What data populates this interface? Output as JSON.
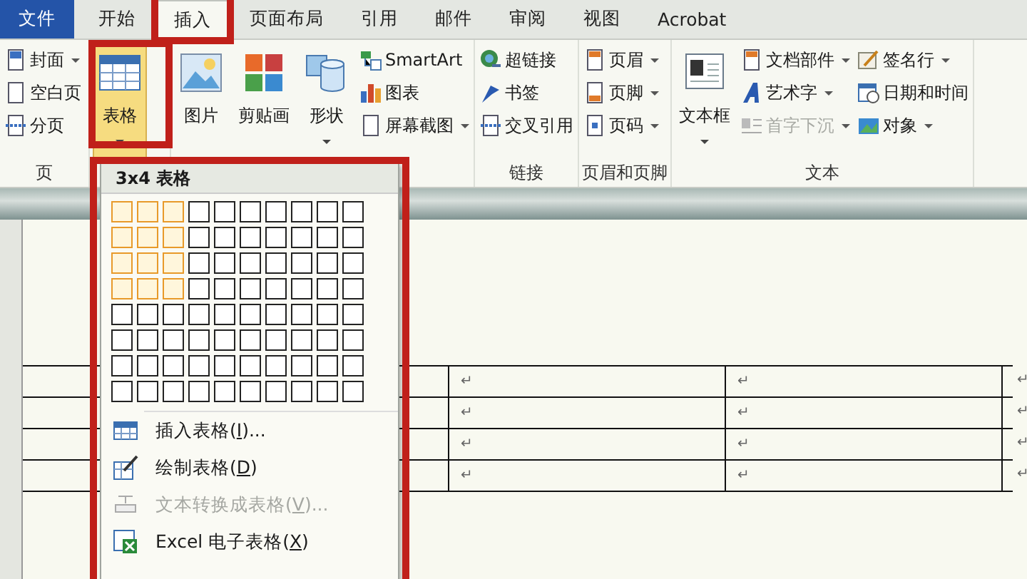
{
  "tabs": [
    {
      "label": "文件",
      "kind": "file",
      "selected": false
    },
    {
      "label": "开始",
      "kind": "tab",
      "selected": false
    },
    {
      "label": "插入",
      "kind": "tab",
      "selected": true
    },
    {
      "label": "页面布局",
      "kind": "tab",
      "selected": false
    },
    {
      "label": "引用",
      "kind": "tab",
      "selected": false
    },
    {
      "label": "邮件",
      "kind": "tab",
      "selected": false
    },
    {
      "label": "审阅",
      "kind": "tab",
      "selected": false
    },
    {
      "label": "视图",
      "kind": "tab",
      "selected": false
    },
    {
      "label": "Acrobat",
      "kind": "tab",
      "selected": false
    }
  ],
  "ribbon": {
    "groups": [
      {
        "label": "页",
        "columns": [
          {
            "kind": "small",
            "items": [
              {
                "label": "封面",
                "dropdown": true,
                "disabled": false
              },
              {
                "label": "空白页",
                "dropdown": false,
                "disabled": false
              },
              {
                "label": "分页",
                "dropdown": false,
                "disabled": false
              }
            ]
          }
        ]
      },
      {
        "columns": [
          {
            "kind": "large",
            "items": [
              {
                "label": "表格",
                "dropdown": true,
                "disabled": false,
                "pressed": true
              }
            ]
          }
        ]
      },
      {
        "columns": [
          {
            "kind": "large",
            "items": [
              {
                "label": "图片",
                "dropdown": false,
                "disabled": false,
                "pressed": false
              },
              {
                "label": "剪贴画",
                "dropdown": false,
                "disabled": false,
                "pressed": false
              },
              {
                "label": "形状",
                "dropdown": true,
                "disabled": false,
                "pressed": false
              }
            ]
          },
          {
            "kind": "small",
            "items": [
              {
                "label": "SmartArt",
                "dropdown": false,
                "disabled": false
              },
              {
                "label": "图表",
                "dropdown": false,
                "disabled": false
              },
              {
                "label": "屏幕截图",
                "dropdown": true,
                "disabled": false
              }
            ]
          }
        ]
      },
      {
        "label": "链接",
        "columns": [
          {
            "kind": "small",
            "items": [
              {
                "label": "超链接",
                "dropdown": false,
                "disabled": false
              },
              {
                "label": "书签",
                "dropdown": false,
                "disabled": false
              },
              {
                "label": "交叉引用",
                "dropdown": false,
                "disabled": false
              }
            ]
          }
        ]
      },
      {
        "label": "页眉和页脚",
        "columns": [
          {
            "kind": "small",
            "items": [
              {
                "label": "页眉",
                "dropdown": true,
                "disabled": false
              },
              {
                "label": "页脚",
                "dropdown": true,
                "disabled": false
              },
              {
                "label": "页码",
                "dropdown": true,
                "disabled": false
              }
            ]
          }
        ]
      },
      {
        "label": "文本",
        "columns": [
          {
            "kind": "large",
            "items": [
              {
                "label": "文本框",
                "dropdown": true,
                "disabled": false,
                "pressed": false
              }
            ]
          },
          {
            "kind": "small",
            "items": [
              {
                "label": "文档部件",
                "dropdown": true,
                "disabled": false
              },
              {
                "label": "艺术字",
                "dropdown": true,
                "disabled": false
              },
              {
                "label": "首字下沉",
                "dropdown": true,
                "disabled": true
              }
            ]
          },
          {
            "kind": "small",
            "items": [
              {
                "label": "签名行",
                "dropdown": true,
                "disabled": false
              },
              {
                "label": "日期和时间",
                "dropdown": false,
                "disabled": false
              },
              {
                "label": "对象",
                "dropdown": true,
                "disabled": false
              }
            ]
          }
        ]
      }
    ]
  },
  "table_menu": {
    "header": "3x4 表格",
    "grid": [
      {
        "cells": [
          {
            "selected": true
          },
          {
            "selected": true
          },
          {
            "selected": true
          },
          {
            "selected": false
          },
          {
            "selected": false
          },
          {
            "selected": false
          },
          {
            "selected": false
          },
          {
            "selected": false
          },
          {
            "selected": false
          },
          {
            "selected": false
          }
        ]
      },
      {
        "cells": [
          {
            "selected": true
          },
          {
            "selected": true
          },
          {
            "selected": true
          },
          {
            "selected": false
          },
          {
            "selected": false
          },
          {
            "selected": false
          },
          {
            "selected": false
          },
          {
            "selected": false
          },
          {
            "selected": false
          },
          {
            "selected": false
          }
        ]
      },
      {
        "cells": [
          {
            "selected": true
          },
          {
            "selected": true
          },
          {
            "selected": true
          },
          {
            "selected": false
          },
          {
            "selected": false
          },
          {
            "selected": false
          },
          {
            "selected": false
          },
          {
            "selected": false
          },
          {
            "selected": false
          },
          {
            "selected": false
          }
        ]
      },
      {
        "cells": [
          {
            "selected": true
          },
          {
            "selected": true
          },
          {
            "selected": true
          },
          {
            "selected": false
          },
          {
            "selected": false
          },
          {
            "selected": false
          },
          {
            "selected": false
          },
          {
            "selected": false
          },
          {
            "selected": false
          },
          {
            "selected": false
          }
        ]
      },
      {
        "cells": [
          {
            "selected": false
          },
          {
            "selected": false
          },
          {
            "selected": false
          },
          {
            "selected": false
          },
          {
            "selected": false
          },
          {
            "selected": false
          },
          {
            "selected": false
          },
          {
            "selected": false
          },
          {
            "selected": false
          },
          {
            "selected": false
          }
        ]
      },
      {
        "cells": [
          {
            "selected": false
          },
          {
            "selected": false
          },
          {
            "selected": false
          },
          {
            "selected": false
          },
          {
            "selected": false
          },
          {
            "selected": false
          },
          {
            "selected": false
          },
          {
            "selected": false
          },
          {
            "selected": false
          },
          {
            "selected": false
          }
        ]
      },
      {
        "cells": [
          {
            "selected": false
          },
          {
            "selected": false
          },
          {
            "selected": false
          },
          {
            "selected": false
          },
          {
            "selected": false
          },
          {
            "selected": false
          },
          {
            "selected": false
          },
          {
            "selected": false
          },
          {
            "selected": false
          },
          {
            "selected": false
          }
        ]
      },
      {
        "cells": [
          {
            "selected": false
          },
          {
            "selected": false
          },
          {
            "selected": false
          },
          {
            "selected": false
          },
          {
            "selected": false
          },
          {
            "selected": false
          },
          {
            "selected": false
          },
          {
            "selected": false
          },
          {
            "selected": false
          },
          {
            "selected": false
          }
        ]
      }
    ],
    "items": [
      {
        "before": "插入表格(",
        "key": "I",
        "after": ")...",
        "disabled": false
      },
      {
        "before": "绘制表格(",
        "key": "D",
        "after": ")",
        "disabled": false
      },
      {
        "before": "文本转换成表格(",
        "key": "V",
        "after": ")...",
        "disabled": true
      },
      {
        "before": "Excel 电子表格(",
        "key": "X",
        "after": ")",
        "disabled": false
      }
    ]
  },
  "document_table": {
    "rows": [
      {
        "cells": [
          "↵",
          "↵"
        ],
        "end": "↵"
      },
      {
        "cells": [
          "↵",
          "↵"
        ],
        "end": "↵"
      },
      {
        "cells": [
          "↵",
          "↵"
        ],
        "end": "↵"
      },
      {
        "cells": [
          "↵",
          "↵"
        ],
        "end": "↵"
      }
    ]
  }
}
